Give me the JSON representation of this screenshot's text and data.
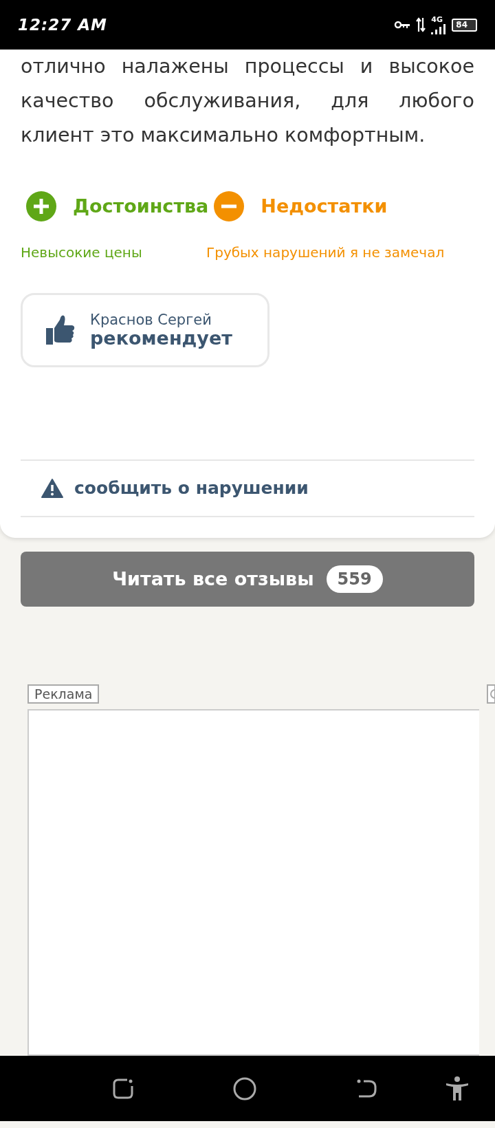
{
  "status_bar": {
    "time": "12:27 AM",
    "network": "4G",
    "battery": "84"
  },
  "review": {
    "text_lines": [
      "отлично налажены процессы и высокое",
      "качество обслуживания, для любого",
      "клиент это максимально комфортным."
    ],
    "pros": {
      "title": "Достоинства",
      "items": [
        "Невысокие цены"
      ]
    },
    "cons": {
      "title": "Недостатки",
      "items": [
        "Грубых нарушений я не замечал"
      ]
    },
    "recommendation": {
      "author": "Краснов Сергей",
      "verdict": "рекомендует"
    },
    "report_link": "сообщить о нарушении"
  },
  "read_all_button": {
    "label": "Читать все отзывы",
    "count": "559"
  },
  "ad": {
    "label": "Реклама"
  }
}
